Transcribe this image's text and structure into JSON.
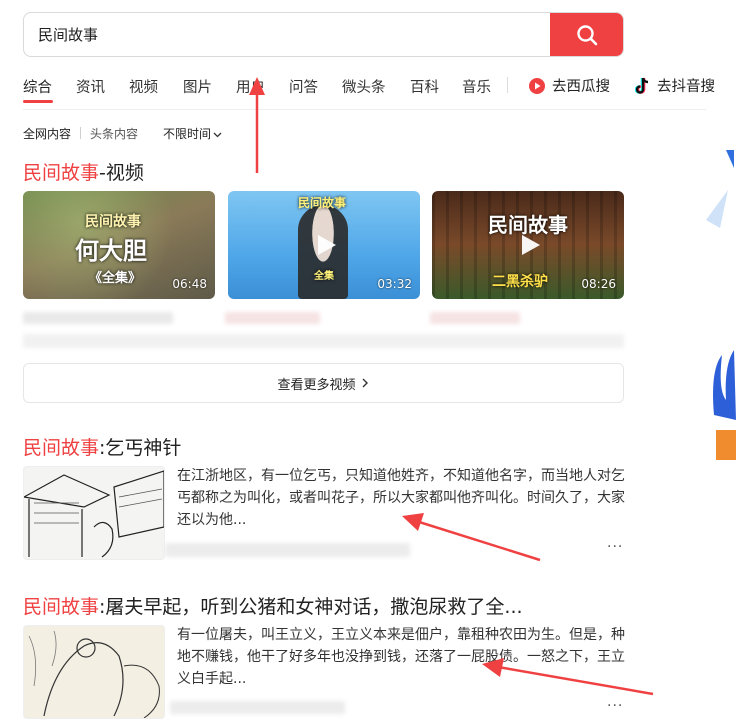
{
  "search": {
    "query": "民间故事",
    "icon": "search-icon"
  },
  "tabs": [
    {
      "label": "综合",
      "active": true
    },
    {
      "label": "资讯"
    },
    {
      "label": "视频"
    },
    {
      "label": "图片"
    },
    {
      "label": "用户"
    },
    {
      "label": "问答"
    },
    {
      "label": "微头条"
    },
    {
      "label": "百科"
    },
    {
      "label": "音乐"
    }
  ],
  "external_links": [
    {
      "label": "去西瓜搜",
      "icon": "xigua-play-icon"
    },
    {
      "label": "去抖音搜",
      "icon": "douyin-note-icon"
    }
  ],
  "filters": {
    "all_web": "全网内容",
    "toutiao": "头条内容",
    "time": "不限时间"
  },
  "video_section": {
    "title_highlight": "民间故事",
    "title_rest": "-视频",
    "videos": [
      {
        "overlay_top": "民间故事",
        "overlay_main": "何大胆",
        "overlay_sub": "《全集》",
        "duration": "06:48"
      },
      {
        "overlay_top": "民间故事",
        "overlay_sub": "全集",
        "duration": "03:32"
      },
      {
        "overlay_top": "民间故事",
        "overlay_sub": "二黑杀驴",
        "duration": "08:26"
      }
    ],
    "more_label": "查看更多视频",
    "more_icon": "chevron-right-icon"
  },
  "results": [
    {
      "title_highlight": "民间故事",
      "title_rest": ":乞丐神针",
      "snippet": "在江浙地区，有一位乞丐，只知道他姓齐，不知道他名字，而当地人对乞丐都称之为叫化，或者叫花子，所以大家都叫他齐叫化。时间久了，大家还以为他...",
      "more": "···"
    },
    {
      "title_highlight": "民间故事",
      "title_rest": ":屠夫早起，听到公猪和女神对话，撒泡尿救了全...",
      "snippet": "有一位屠夫，叫王立义，王立义本来是佃户，靠租种农田为生。但是，种地不赚钱，他干了好多年也没挣到钱，还落了一屁股债。一怒之下，王立义白手起...",
      "more": "···"
    }
  ],
  "colors": {
    "accent": "#f04142",
    "annotation_arrow": "#f04142"
  }
}
